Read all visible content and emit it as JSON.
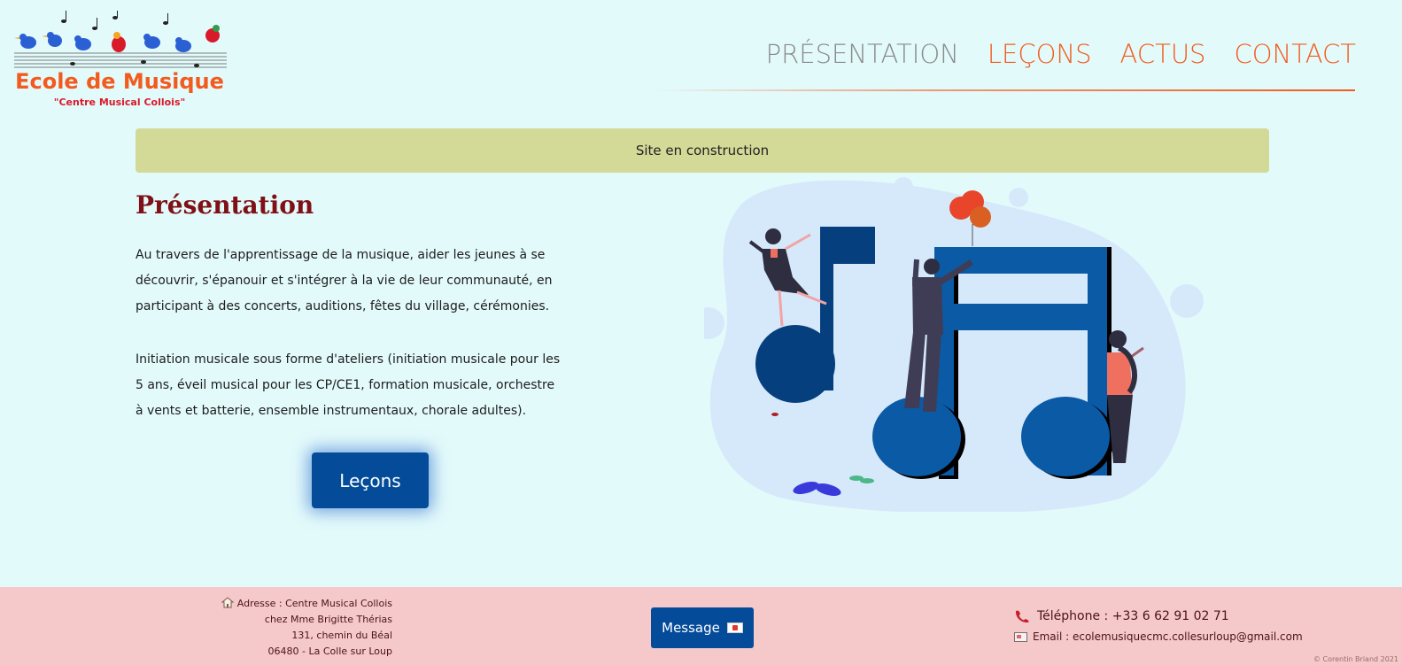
{
  "header": {
    "logo_title": "Ecole de Musique",
    "logo_subtitle": "\"Centre Musical Collois\"",
    "nav": [
      {
        "label": "PRÉSENTATION",
        "color": "#8a8a8a"
      },
      {
        "label": "LEÇONS",
        "color": "#f25b1b"
      },
      {
        "label": "ACTUS",
        "color": "#f25b1b"
      },
      {
        "label": "CONTACT",
        "color": "#f25b1b"
      }
    ]
  },
  "banner": {
    "text": "Site en construction",
    "color": "#d3d997"
  },
  "presentation": {
    "title": "Présentation",
    "paragraph_1": "Au travers de l'apprentissage de la musique, aider les jeunes à se découvrir, s'épanouir et s'intégrer à la vie de leur communauté, en participant à des concerts, auditions, fêtes du village, cérémonies.",
    "paragraph_2": "Initiation musicale sous forme d'ateliers (initiation musicale pour les 5 ans, éveil musical pour les CP/CE1, formation musicale, orchestre à vents et batterie, ensemble instrumentaux, chorale adultes).",
    "button_label": "Leçons"
  },
  "illustration": {
    "icon": "music-notes-illustration"
  },
  "footer": {
    "address": [
      "Adresse : Centre Musical Collois",
      "chez Mme Brigitte Thérias",
      "131, chemin du Béal",
      "06480 - La Colle sur Loup"
    ],
    "message_label": "Message",
    "telephone": "Téléphone : +33 6 62 91 02 71",
    "email": "Email : ecolemusiquecmc.collesurloup@gmail.com",
    "copyright": "© Corentin Briand 2021"
  },
  "colors": {
    "background": "#e3fafb",
    "accent_orange": "#f25b1b",
    "button_blue": "#044b99",
    "title_red": "#7f1016",
    "footer_bg": "#f5c8c9"
  }
}
